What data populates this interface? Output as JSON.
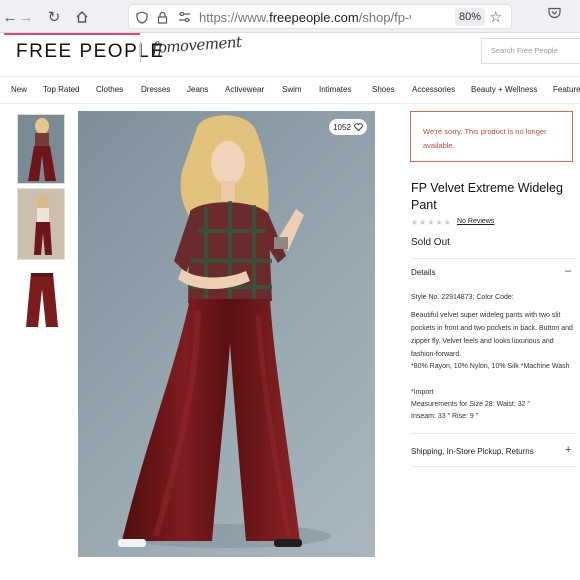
{
  "browser": {
    "url_prefix": "https://www.",
    "url_domain": "freepeople.com",
    "url_path": "/shop/fp-vintage-velv",
    "zoom": "80%"
  },
  "header": {
    "logo": "FREE PEOPLE",
    "sub_brand": "fpmovement",
    "search_placeholder": "Search Free People"
  },
  "nav": {
    "items": [
      "New",
      "Top Rated",
      "Clothes",
      "Dresses",
      "Jeans",
      "Activewear",
      "Swim",
      "Intimates",
      "Shoes",
      "Accessories",
      "Beauty + Wellness",
      "Feature"
    ]
  },
  "gallery": {
    "like_count": "1052"
  },
  "product": {
    "alert": "We're sorry. This product is no longer available.",
    "title": "FP Velvet Extreme Wideleg Pant",
    "rating_stars": "★★★★★",
    "reviews": "No Reviews",
    "status": "Sold Out",
    "details_label": "Details",
    "details_toggle": "–",
    "style_line": "Style No. 22914873; Color Code:",
    "description": "Beautiful velvet super wideleg pants with two slit pockets in front and two pockets in back. Button and zipper fly. Velvet feels and looks luxurious and fashion-forward.",
    "material": "*80% Rayon, 10% Nylon, 10% Silk *Machine Wash",
    "import": "*Import",
    "measurements_1": "Measurements for Size 28: Waist: 32 \"",
    "measurements_2": "Inseam: 33 \" Rise: 9 \"",
    "shipping_label": "Shipping, In-Store Pickup, Returns",
    "shipping_toggle": "+"
  },
  "colors": {
    "accent_pink": "#e8447a",
    "alert_red": "#c4483a",
    "velvet": "#6e1618"
  }
}
